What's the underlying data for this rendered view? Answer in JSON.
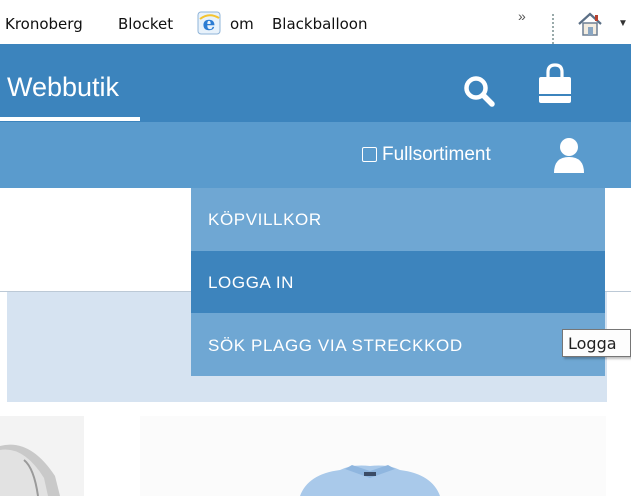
{
  "favorites_bar": {
    "links": [
      "Kronoberg",
      "Blocket",
      "om",
      "Blackballoon"
    ]
  },
  "header": {
    "brand": "Webbutik",
    "color": "#3c84bd"
  },
  "subbar": {
    "fullsortiment_label": "Fullsortiment",
    "fullsortiment_checked": false,
    "color": "#5a9bcd"
  },
  "menu": {
    "items": [
      {
        "label": "KÖPVILLKOR",
        "active": false
      },
      {
        "label": "LOGGA IN",
        "active": true
      },
      {
        "label": "SÖK PLAGG VIA STRECKKOD",
        "active": false
      }
    ]
  },
  "tooltip": {
    "text": "Logga"
  },
  "icons": {
    "favorites": "ie-icon",
    "more": "chevron-double-right-icon",
    "home": "home-icon",
    "search": "search-icon",
    "cart": "shopping-bag-icon",
    "user": "user-icon"
  }
}
